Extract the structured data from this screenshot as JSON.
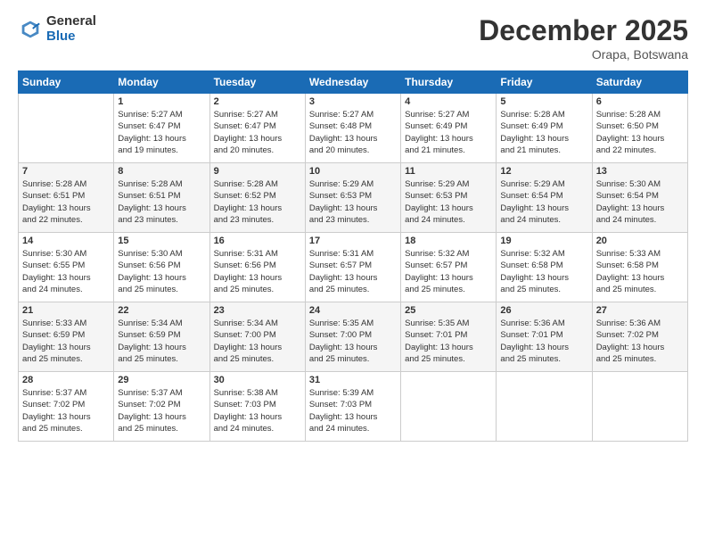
{
  "header": {
    "logo_general": "General",
    "logo_blue": "Blue",
    "month_title": "December 2025",
    "location": "Orapa, Botswana"
  },
  "calendar": {
    "days_of_week": [
      "Sunday",
      "Monday",
      "Tuesday",
      "Wednesday",
      "Thursday",
      "Friday",
      "Saturday"
    ],
    "weeks": [
      [
        {
          "day": "",
          "content": ""
        },
        {
          "day": "1",
          "content": "Sunrise: 5:27 AM\nSunset: 6:47 PM\nDaylight: 13 hours\nand 19 minutes."
        },
        {
          "day": "2",
          "content": "Sunrise: 5:27 AM\nSunset: 6:47 PM\nDaylight: 13 hours\nand 20 minutes."
        },
        {
          "day": "3",
          "content": "Sunrise: 5:27 AM\nSunset: 6:48 PM\nDaylight: 13 hours\nand 20 minutes."
        },
        {
          "day": "4",
          "content": "Sunrise: 5:27 AM\nSunset: 6:49 PM\nDaylight: 13 hours\nand 21 minutes."
        },
        {
          "day": "5",
          "content": "Sunrise: 5:28 AM\nSunset: 6:49 PM\nDaylight: 13 hours\nand 21 minutes."
        },
        {
          "day": "6",
          "content": "Sunrise: 5:28 AM\nSunset: 6:50 PM\nDaylight: 13 hours\nand 22 minutes."
        }
      ],
      [
        {
          "day": "7",
          "content": "Sunrise: 5:28 AM\nSunset: 6:51 PM\nDaylight: 13 hours\nand 22 minutes."
        },
        {
          "day": "8",
          "content": "Sunrise: 5:28 AM\nSunset: 6:51 PM\nDaylight: 13 hours\nand 23 minutes."
        },
        {
          "day": "9",
          "content": "Sunrise: 5:28 AM\nSunset: 6:52 PM\nDaylight: 13 hours\nand 23 minutes."
        },
        {
          "day": "10",
          "content": "Sunrise: 5:29 AM\nSunset: 6:53 PM\nDaylight: 13 hours\nand 23 minutes."
        },
        {
          "day": "11",
          "content": "Sunrise: 5:29 AM\nSunset: 6:53 PM\nDaylight: 13 hours\nand 24 minutes."
        },
        {
          "day": "12",
          "content": "Sunrise: 5:29 AM\nSunset: 6:54 PM\nDaylight: 13 hours\nand 24 minutes."
        },
        {
          "day": "13",
          "content": "Sunrise: 5:30 AM\nSunset: 6:54 PM\nDaylight: 13 hours\nand 24 minutes."
        }
      ],
      [
        {
          "day": "14",
          "content": "Sunrise: 5:30 AM\nSunset: 6:55 PM\nDaylight: 13 hours\nand 24 minutes."
        },
        {
          "day": "15",
          "content": "Sunrise: 5:30 AM\nSunset: 6:56 PM\nDaylight: 13 hours\nand 25 minutes."
        },
        {
          "day": "16",
          "content": "Sunrise: 5:31 AM\nSunset: 6:56 PM\nDaylight: 13 hours\nand 25 minutes."
        },
        {
          "day": "17",
          "content": "Sunrise: 5:31 AM\nSunset: 6:57 PM\nDaylight: 13 hours\nand 25 minutes."
        },
        {
          "day": "18",
          "content": "Sunrise: 5:32 AM\nSunset: 6:57 PM\nDaylight: 13 hours\nand 25 minutes."
        },
        {
          "day": "19",
          "content": "Sunrise: 5:32 AM\nSunset: 6:58 PM\nDaylight: 13 hours\nand 25 minutes."
        },
        {
          "day": "20",
          "content": "Sunrise: 5:33 AM\nSunset: 6:58 PM\nDaylight: 13 hours\nand 25 minutes."
        }
      ],
      [
        {
          "day": "21",
          "content": "Sunrise: 5:33 AM\nSunset: 6:59 PM\nDaylight: 13 hours\nand 25 minutes."
        },
        {
          "day": "22",
          "content": "Sunrise: 5:34 AM\nSunset: 6:59 PM\nDaylight: 13 hours\nand 25 minutes."
        },
        {
          "day": "23",
          "content": "Sunrise: 5:34 AM\nSunset: 7:00 PM\nDaylight: 13 hours\nand 25 minutes."
        },
        {
          "day": "24",
          "content": "Sunrise: 5:35 AM\nSunset: 7:00 PM\nDaylight: 13 hours\nand 25 minutes."
        },
        {
          "day": "25",
          "content": "Sunrise: 5:35 AM\nSunset: 7:01 PM\nDaylight: 13 hours\nand 25 minutes."
        },
        {
          "day": "26",
          "content": "Sunrise: 5:36 AM\nSunset: 7:01 PM\nDaylight: 13 hours\nand 25 minutes."
        },
        {
          "day": "27",
          "content": "Sunrise: 5:36 AM\nSunset: 7:02 PM\nDaylight: 13 hours\nand 25 minutes."
        }
      ],
      [
        {
          "day": "28",
          "content": "Sunrise: 5:37 AM\nSunset: 7:02 PM\nDaylight: 13 hours\nand 25 minutes."
        },
        {
          "day": "29",
          "content": "Sunrise: 5:37 AM\nSunset: 7:02 PM\nDaylight: 13 hours\nand 25 minutes."
        },
        {
          "day": "30",
          "content": "Sunrise: 5:38 AM\nSunset: 7:03 PM\nDaylight: 13 hours\nand 24 minutes."
        },
        {
          "day": "31",
          "content": "Sunrise: 5:39 AM\nSunset: 7:03 PM\nDaylight: 13 hours\nand 24 minutes."
        },
        {
          "day": "",
          "content": ""
        },
        {
          "day": "",
          "content": ""
        },
        {
          "day": "",
          "content": ""
        }
      ]
    ]
  }
}
